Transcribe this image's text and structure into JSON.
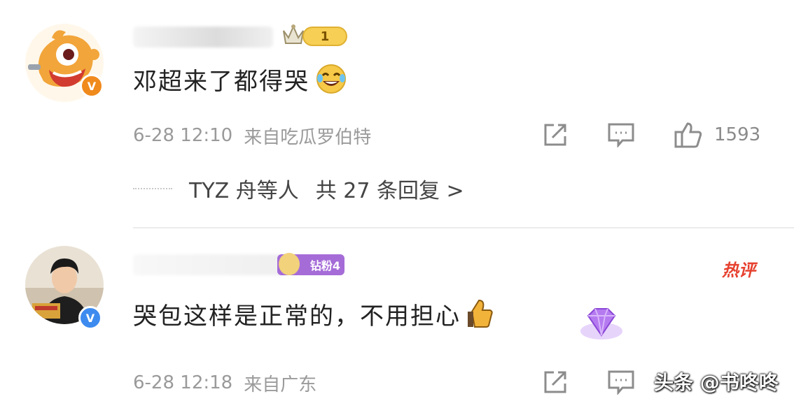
{
  "comments": [
    {
      "text": "邓超来了都得哭",
      "emoji": "laughing-crying-emoji",
      "level": "1",
      "verify_mark": "V",
      "date": "6-28 12:10",
      "source": "来自吃瓜罗伯特",
      "likes": "1593",
      "replies": {
        "names": "TYZ 舟等人",
        "count": "共 27 条回复 >"
      }
    },
    {
      "text": "哭包这样是正常的，不用担心",
      "emoji": "thumbs-up-emoji",
      "fan_badge": "钻粉4",
      "hot_badge": "热评",
      "verify_mark": "V",
      "date": "6-28 12:18",
      "source": "来自广东"
    }
  ],
  "watermark": "头条 @书咚咚",
  "colors": {
    "hot": "#e6412f",
    "verify_blue": "#3d8bef",
    "verify_orange": "#f08a1c",
    "fan_badge": "#a56cd8"
  }
}
